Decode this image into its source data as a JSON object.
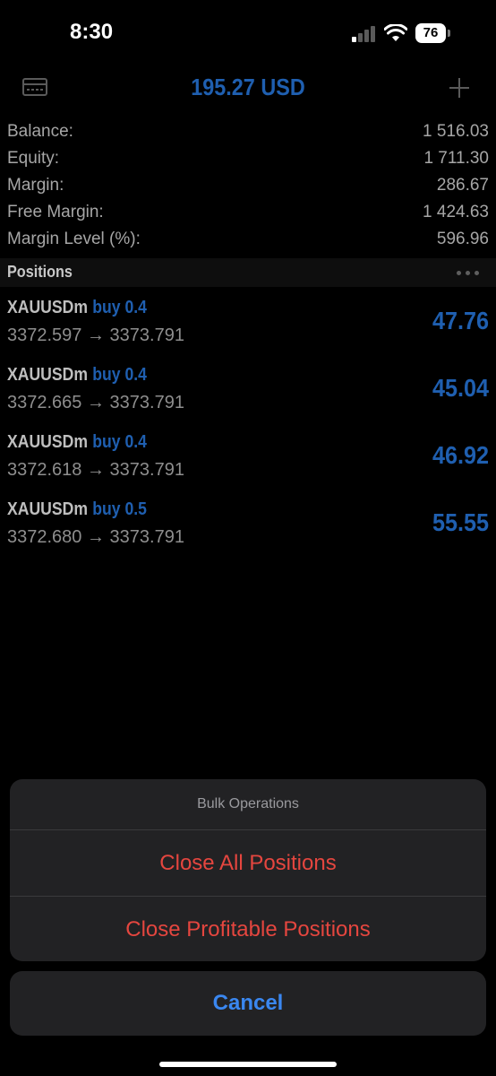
{
  "status_bar": {
    "time": "8:30",
    "battery": "76",
    "signal_bars_filled": 1,
    "signal_bars_total": 4,
    "icons": [
      "signal-icon",
      "wifi-icon",
      "battery-icon"
    ]
  },
  "header": {
    "title": "195.27 USD",
    "left_icon": "card-icon",
    "right_icon": "plus-icon"
  },
  "summary": [
    {
      "label": "Balance:",
      "value": "1 516.03"
    },
    {
      "label": "Equity:",
      "value": "1 711.30"
    },
    {
      "label": "Margin:",
      "value": "286.67"
    },
    {
      "label": "Free Margin:",
      "value": "1 424.63"
    },
    {
      "label": "Margin Level (%):",
      "value": "596.96"
    }
  ],
  "positions_section": {
    "title": "Positions",
    "menu_icon": "more-icon"
  },
  "positions": [
    {
      "symbol": "XAUUSDm",
      "side": "buy 0.4",
      "prices": "3372.597 → 3373.791",
      "profit": "47.76"
    },
    {
      "symbol": "XAUUSDm",
      "side": "buy 0.4",
      "prices": "3372.665 → 3373.791",
      "profit": "45.04"
    },
    {
      "symbol": "XAUUSDm",
      "side": "buy 0.4",
      "prices": "3372.618 → 3373.791",
      "profit": "46.92"
    },
    {
      "symbol": "XAUUSDm",
      "side": "buy 0.5",
      "prices": "3372.680 → 3373.791",
      "profit": "55.55"
    }
  ],
  "action_sheet": {
    "title": "Bulk Operations",
    "actions": [
      {
        "label": "Close All Positions"
      },
      {
        "label": "Close Profitable Positions"
      }
    ],
    "cancel_label": "Cancel"
  },
  "colors": {
    "accent_blue": "#1f5fb0",
    "destructive_red": "#e5463f",
    "cancel_blue": "#3a87f0",
    "background": "#000000"
  }
}
